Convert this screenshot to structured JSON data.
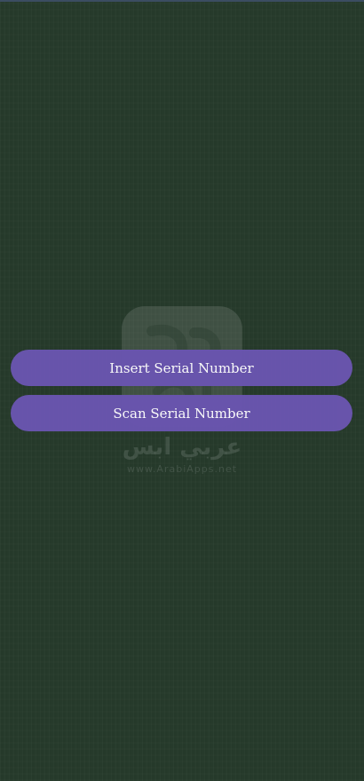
{
  "buttons": {
    "insert_label": "Insert Serial Number",
    "scan_label": "Scan Serial Number"
  },
  "watermark": {
    "arabic_text": "عربي ابس",
    "url_text": "www.ArabiApps.net"
  },
  "colors": {
    "background": "#263a2b",
    "button": "#6a55b0",
    "button_text": "#ffffff"
  }
}
